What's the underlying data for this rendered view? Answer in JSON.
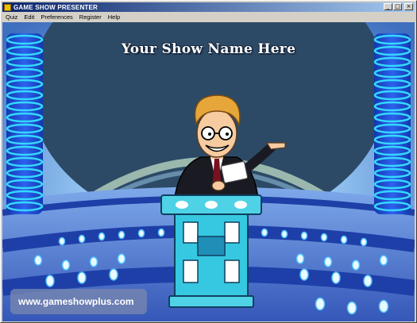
{
  "window": {
    "title": "GAME SHOW PRESENTER",
    "minimize_glyph": "_",
    "maximize_glyph": "□",
    "close_glyph": "×"
  },
  "menu": {
    "items": [
      "Quiz",
      "Edit",
      "Preferences",
      "Register",
      "Help"
    ]
  },
  "stage": {
    "show_title": "Your Show Name Here",
    "website": "www.gameshowplus.com"
  },
  "colors": {
    "titlebar_start": "#0a246a",
    "titlebar_end": "#a6caf0",
    "backdrop": "#2c4a66",
    "floor": "#4f82d4",
    "pillar": "#1f4fd6",
    "pillar_ring": "#35d8ff",
    "podium": "#36c8e0"
  },
  "icons": {
    "app": "app-icon",
    "minimize": "minimize-icon",
    "maximize": "maximize-icon",
    "close": "close-icon"
  }
}
